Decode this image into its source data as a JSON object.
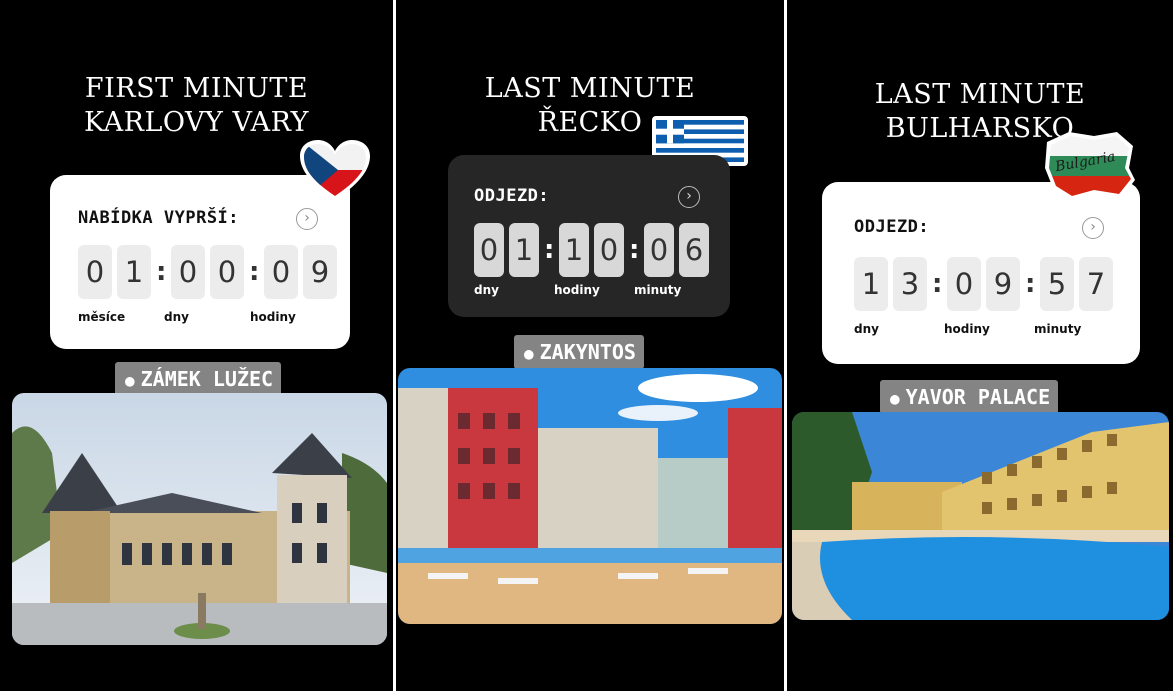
{
  "stories": [
    {
      "title_lines": [
        "FIRST MINUTE",
        "KARLOVY VARY"
      ],
      "countdown_label": "NABÍDKA VYPRŠÍ:",
      "digits": [
        "0",
        "1",
        "0",
        "0",
        "0",
        "9"
      ],
      "units": [
        "měsíce",
        "dny",
        "hodiny"
      ],
      "location": "ZÁMEK LUŽEC",
      "flag_sticker": "czech-heart-icon"
    },
    {
      "title_lines": [
        "LAST MINUTE",
        "ŘECKO"
      ],
      "countdown_label": "ODJEZD:",
      "digits": [
        "0",
        "1",
        "1",
        "0",
        "0",
        "6"
      ],
      "units": [
        "dny",
        "hodiny",
        "minuty"
      ],
      "location": "ZAKYNTOS",
      "flag_sticker": "greek-flag-icon"
    },
    {
      "title_lines": [
        "LAST MINUTE",
        "BULHARSKO"
      ],
      "countdown_label": "ODJEZD:",
      "digits": [
        "1",
        "3",
        "0",
        "9",
        "5",
        "7"
      ],
      "units": [
        "dny",
        "hodiny",
        "minuty"
      ],
      "location": "YAVOR PALACE",
      "flag_sticker": "bulgaria-map-icon",
      "sticker_text": "Bulgaria"
    }
  ],
  "colors": {
    "background": "#000000",
    "card_light": "#ffffff",
    "card_dark": "#262626",
    "digit_tile": "#ececec",
    "location_chip": "#9b9b9b"
  }
}
